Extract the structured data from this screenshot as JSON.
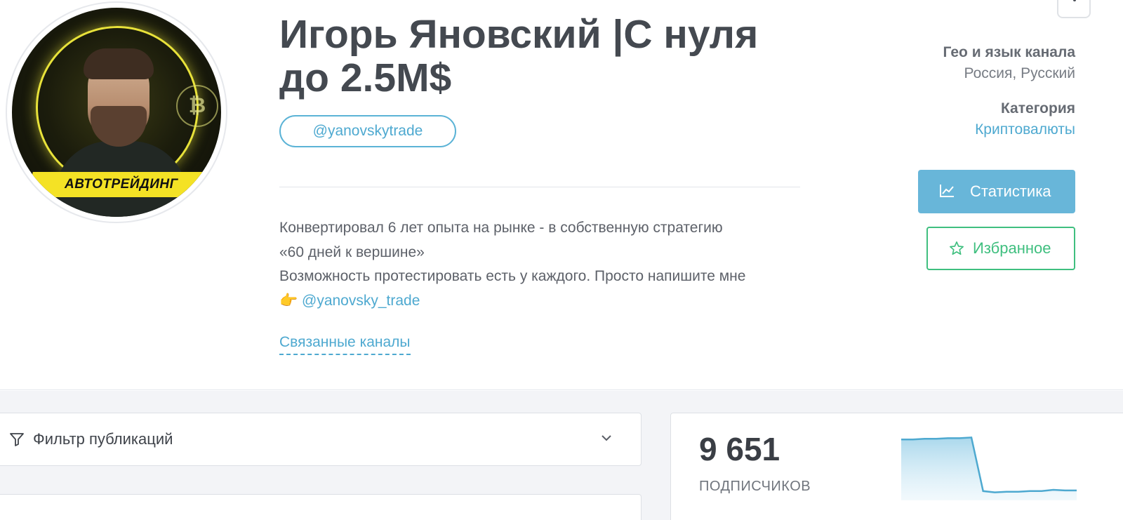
{
  "channel": {
    "title": "Игорь Яновский |С нуля до 2.5M$",
    "handle": "@yanovskytrade",
    "avatar_banner": "АВТОТРЕЙДИНГ",
    "description": {
      "line1": "Конвертировал 6 лет опыта на рынке - в собственную стратегию",
      "line2": "«60 дней к вершине»",
      "line3": "Возможность протестировать есть у каждого. Просто напишите мне",
      "pointer_emoji": "👉",
      "mention": "@yanovsky_trade"
    },
    "related_link": "Связанные каналы"
  },
  "meta": {
    "geo_label": "Гео и язык канала",
    "geo_value": "Россия, Русский",
    "category_label": "Категория",
    "category_value": "Криптовалюты"
  },
  "actions": {
    "stats_label": "Статистика",
    "favorite_label": "Избранное"
  },
  "filter": {
    "label": "Фильтр публикаций"
  },
  "subscribers": {
    "count": "9 651",
    "label": "ПОДПИСЧИКОВ",
    "trend": [
      0.9,
      0.9,
      0.91,
      0.91,
      0.92,
      0.92,
      0.93,
      0.1,
      0.08,
      0.09,
      0.09,
      0.1,
      0.1,
      0.12,
      0.11,
      0.11
    ]
  },
  "colors": {
    "accent_blue": "#68b6d9",
    "link_blue": "#4ea9d0",
    "favorite_green": "#3fbf7f",
    "avatar_yellow": "#f4e225"
  }
}
